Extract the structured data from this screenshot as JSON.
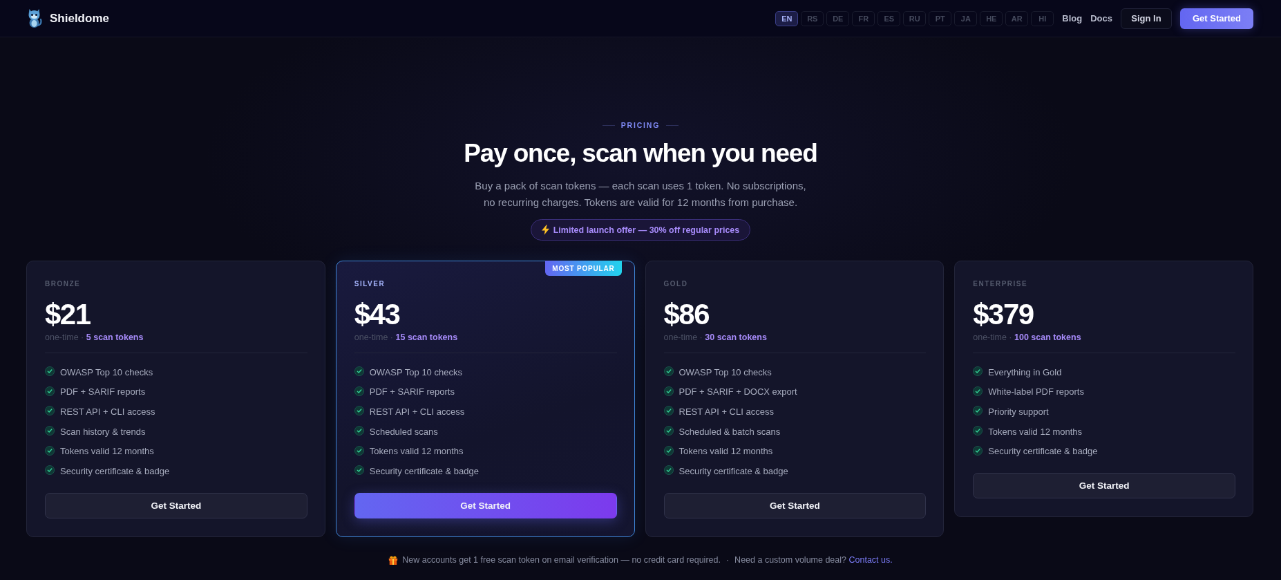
{
  "nav": {
    "brand": "Shieldome",
    "languages": [
      {
        "label": "EN",
        "selected": true
      },
      {
        "label": "RS",
        "selected": false
      },
      {
        "label": "DE",
        "selected": false
      },
      {
        "label": "FR",
        "selected": false
      },
      {
        "label": "ES",
        "selected": false
      },
      {
        "label": "RU",
        "selected": false
      },
      {
        "label": "PT",
        "selected": false
      },
      {
        "label": "JA",
        "selected": false
      },
      {
        "label": "HE",
        "selected": false
      },
      {
        "label": "AR",
        "selected": false
      },
      {
        "label": "HI",
        "selected": false
      }
    ],
    "links": [
      "Blog",
      "Docs"
    ],
    "sign_in": "Sign In",
    "cta": "Get Started"
  },
  "hero": {
    "eyebrow": "PRICING",
    "title": "Pay once, scan when you need",
    "subtitle": "Buy a pack of scan tokens — each scan uses 1 token. No subscriptions, no recurring charges. Tokens are valid for 12 months from purchase.",
    "offer": "Limited launch offer — 30% off regular prices"
  },
  "plans": [
    {
      "tier": "BRONZE",
      "featured": false,
      "price": "$21",
      "billing": "one-time · **5 scan tokens**",
      "features": [
        "OWASP Top 10 checks",
        "PDF + SARIF reports",
        "REST API + CLI access",
        "Scan history & trends",
        "Tokens valid 12 months",
        "Security certificate & badge"
      ],
      "button": "Get Started"
    },
    {
      "tier": "SILVER",
      "featured": true,
      "badge": "MOST POPULAR",
      "price": "$43",
      "billing": "one-time · **15 scan tokens**",
      "features": [
        "OWASP Top 10 checks",
        "PDF + SARIF reports",
        "REST API + CLI access",
        "Scheduled scans",
        "Tokens valid 12 months",
        "Security certificate & badge"
      ],
      "button": "Get Started"
    },
    {
      "tier": "GOLD",
      "featured": false,
      "price": "$86",
      "billing": "one-time · **30 scan tokens**",
      "features": [
        "OWASP Top 10 checks",
        "PDF + SARIF + DOCX export",
        "REST API + CLI access",
        "Scheduled & batch scans",
        "Tokens valid 12 months",
        "Security certificate & badge"
      ],
      "button": "Get Started"
    },
    {
      "tier": "ENTERPRISE",
      "featured": false,
      "price": "$379",
      "billing": "one-time · **100 scan tokens**",
      "features": [
        "Everything in Gold",
        "White-label PDF reports",
        "Priority support",
        "Tokens valid 12 months",
        "Security certificate & badge"
      ],
      "button": "Get Started"
    }
  ],
  "footer": {
    "note": "New accounts get 1 free scan token on email verification — no credit card required.",
    "separator": "·",
    "question": "Need a custom volume deal?",
    "link": "Contact us."
  }
}
